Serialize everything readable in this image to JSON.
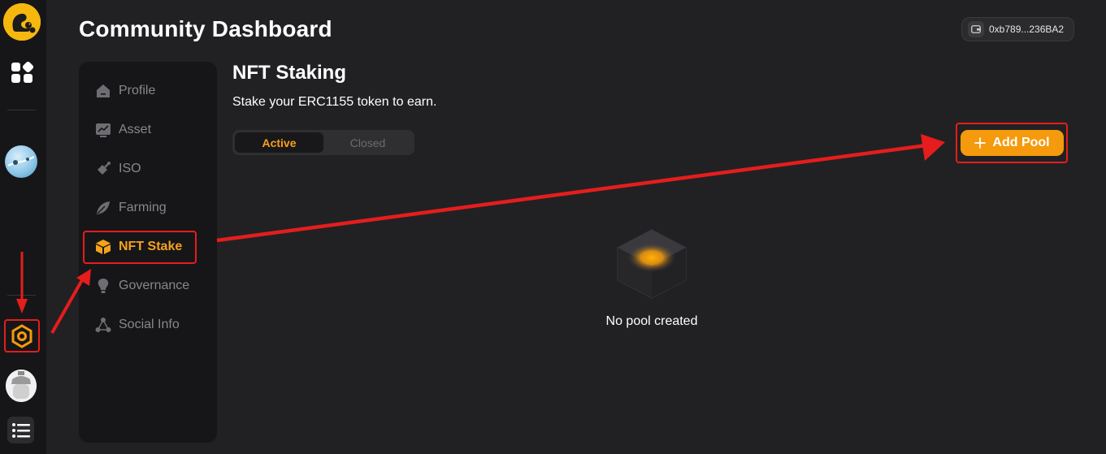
{
  "header": {
    "title": "Community Dashboard",
    "wallet_address": "0xb789...236BA2"
  },
  "rail": {
    "items": [
      "logo",
      "apps",
      "community-avatar",
      "dashboard",
      "user-avatar",
      "menu"
    ]
  },
  "sidebar": {
    "items": [
      {
        "label": "Profile",
        "icon": "house-icon",
        "active": false
      },
      {
        "label": "Asset",
        "icon": "chart-icon",
        "active": false
      },
      {
        "label": "ISO",
        "icon": "shovel-icon",
        "active": false
      },
      {
        "label": "Farming",
        "icon": "leaf-icon",
        "active": false
      },
      {
        "label": "NFT Stake",
        "icon": "cube-icon",
        "active": true
      },
      {
        "label": "Governance",
        "icon": "bulb-icon",
        "active": false
      },
      {
        "label": "Social Info",
        "icon": "share-icon",
        "active": false
      }
    ]
  },
  "main": {
    "title": "NFT Staking",
    "subtitle": "Stake your ERC1155 token to earn.",
    "tabs": [
      {
        "label": "Active",
        "active": true
      },
      {
        "label": "Closed",
        "active": false
      }
    ],
    "add_pool_label": "Add Pool",
    "empty_text": "No pool created"
  },
  "colors": {
    "accent": "#f59a0c",
    "active_text": "#f7a21b",
    "annotation": "#e51d1d",
    "background": "#212123",
    "panel": "#161618"
  }
}
